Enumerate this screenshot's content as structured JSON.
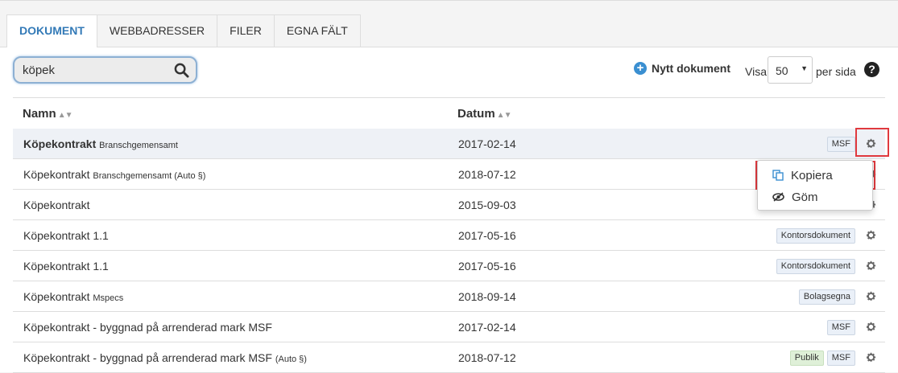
{
  "tabs": [
    {
      "label": "DOKUMENT",
      "active": true
    },
    {
      "label": "WEBBADRESSER",
      "active": false
    },
    {
      "label": "FILER",
      "active": false
    },
    {
      "label": "EGNA FÄLT",
      "active": false
    }
  ],
  "search": {
    "value": "köpek",
    "icon": "search-icon"
  },
  "toolbar": {
    "new_document_label": "Nytt dokument",
    "show_label": "Visa",
    "per_page_value": "50",
    "per_page_suffix": "per sida"
  },
  "table": {
    "columns": {
      "name": "Namn",
      "date": "Datum"
    },
    "rows": [
      {
        "name": "Köpekontrakt",
        "sub": "Branschgemensamt",
        "date": "2017-02-14",
        "badges": [
          "MSF"
        ]
      },
      {
        "name": "Köpekontrakt",
        "sub": "Branschgemensamt (Auto §)",
        "date": "2018-07-12",
        "badges": []
      },
      {
        "name": "Köpekontrakt",
        "sub": "",
        "date": "2015-09-03",
        "badges": []
      },
      {
        "name": "Köpekontrakt 1.1",
        "sub": "",
        "date": "2017-05-16",
        "badges": [
          "Kontorsdokument"
        ]
      },
      {
        "name": "Köpekontrakt 1.1",
        "sub": "",
        "date": "2017-05-16",
        "badges": [
          "Kontorsdokument"
        ]
      },
      {
        "name": "Köpekontrakt",
        "sub": "Mspecs",
        "date": "2018-09-14",
        "badges": [
          "Bolagsegna"
        ]
      },
      {
        "name": "Köpekontrakt - byggnad på arrenderad mark MSF",
        "sub": "",
        "date": "2017-02-14",
        "badges": [
          "MSF"
        ]
      },
      {
        "name": "Köpekontrakt - byggnad på arrenderad mark MSF",
        "sub": "(Auto §)",
        "date": "2018-07-12",
        "badges": [
          "Publik",
          "MSF"
        ]
      }
    ]
  },
  "menu": {
    "copy_label": "Kopiera",
    "hide_label": "Göm"
  },
  "colors": {
    "accent": "#337ab7",
    "highlight_box": "#e0393e",
    "badge_green": "#dff0d8"
  }
}
